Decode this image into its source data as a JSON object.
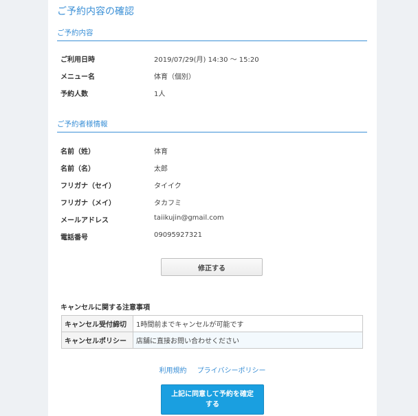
{
  "page_title": "ご予約内容の確認",
  "reservation": {
    "header": "ご予約内容",
    "rows": [
      {
        "label": "ご利用日時",
        "value": "2019/07/29(月) 14:30 〜 15:20"
      },
      {
        "label": "メニュー名",
        "value": "体育（個別）"
      },
      {
        "label": "予約人数",
        "value": "1人"
      }
    ]
  },
  "customer": {
    "header": "ご予約者様情報",
    "rows": [
      {
        "label": "名前（姓）",
        "value": "体育"
      },
      {
        "label": "名前（名）",
        "value": "太郎"
      },
      {
        "label": "フリガナ（セイ）",
        "value": "タイイク"
      },
      {
        "label": "フリガナ（メイ）",
        "value": "タカフミ"
      },
      {
        "label": "メールアドレス",
        "value": "taiikujin@gmail.com"
      },
      {
        "label": "電話番号",
        "value": "09095927321"
      }
    ]
  },
  "edit_button": "修正する",
  "cancel": {
    "title": "キャンセルに関する注意事項",
    "rows": [
      {
        "label": "キャンセル受付締切",
        "value": "1時間前までキャンセルが可能です"
      },
      {
        "label": "キャンセルポリシー",
        "value": "店舗に直接お問い合わせください"
      }
    ]
  },
  "links": {
    "terms": "利用規約",
    "privacy": "プライバシーポリシー"
  },
  "confirm_button": "上記に同意して予約を確定する",
  "colors": {
    "accent": "#3a8fd6",
    "confirm_bg": "#1a9fe0"
  }
}
